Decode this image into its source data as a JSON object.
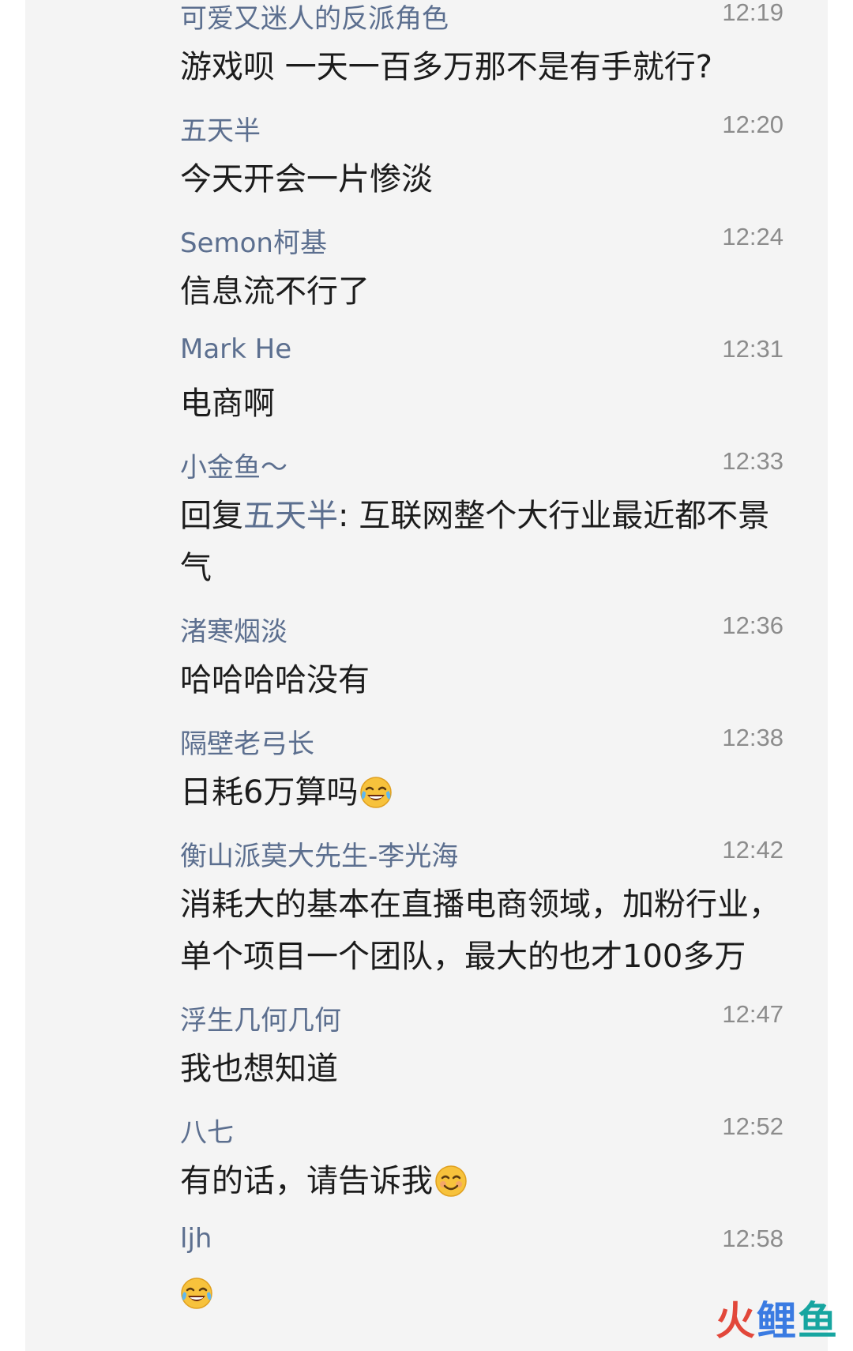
{
  "messages": [
    {
      "sender": "可爱又迷人的反派角色",
      "time": "12:19",
      "text": "游戏呗 一天一百多万那不是有手就行?"
    },
    {
      "sender": "五天半",
      "time": "12:20",
      "text": "今天开会一片惨淡"
    },
    {
      "sender": "Semon柯基",
      "time": "12:24",
      "text": "信息流不行了"
    },
    {
      "sender": "Mark He",
      "time": "12:31",
      "text": "电商啊"
    },
    {
      "sender": "小金鱼～",
      "time": "12:33",
      "reply_prefix": "回复",
      "reply_to": "五天半",
      "text": ": 互联网整个大行业最近都不景气"
    },
    {
      "sender": "渚寒烟淡",
      "time": "12:36",
      "text": "哈哈哈哈没有"
    },
    {
      "sender": "隔壁老弓长",
      "time": "12:38",
      "text": "日耗6万算吗",
      "emoji": "laughing-crying-emoji"
    },
    {
      "sender": "衡山派莫大先生-李光海",
      "time": "12:42",
      "text": "消耗大的基本在直播电商领域，加粉行业，单个项目一个团队，最大的也才100多万"
    },
    {
      "sender": "浮生几何几何",
      "time": "12:47",
      "text": "我也想知道"
    },
    {
      "sender": "八七",
      "time": "12:52",
      "text": "有的话，请告诉我",
      "emoji": "smiling-emoji"
    },
    {
      "sender": "ljh",
      "time": "12:58",
      "text": "",
      "emoji": "laughing-crying-emoji"
    }
  ],
  "watermark": {
    "char1": "火",
    "char2": "鲤",
    "char3": "鱼"
  },
  "colors": {
    "sender": "#5c6f8f",
    "time": "#8c8c8c",
    "text": "#1c1c1c",
    "panel_bg": "#f4f4f4"
  }
}
